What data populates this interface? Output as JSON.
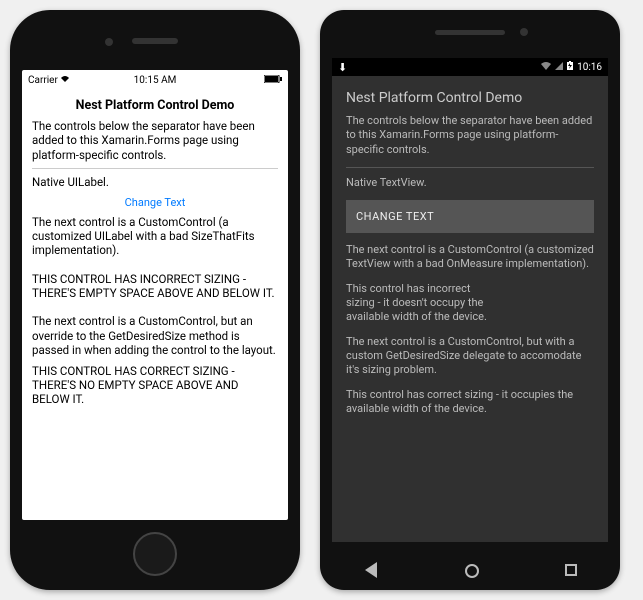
{
  "ios": {
    "status": {
      "carrier": "Carrier",
      "time": "10:15 AM"
    },
    "title": "Nest Platform Control Demo",
    "intro": "The controls below the separator have been added to this Xamarin.Forms page using platform-specific controls.",
    "native_label": "Native UILabel.",
    "change_text": "Change Text",
    "desc1": "The next control is a CustomControl (a customized UILabel with a bad SizeThatFits implementation).",
    "bad_sizing": "THIS CONTROL HAS INCORRECT SIZING - THERE'S EMPTY SPACE ABOVE AND BELOW IT.",
    "desc2": "The next control is a CustomControl, but an override to the GetDesiredSize method is passed in when adding the control to the layout.",
    "good_sizing": "THIS CONTROL HAS CORRECT SIZING - THERE'S NO EMPTY SPACE ABOVE AND BELOW IT."
  },
  "android": {
    "status": {
      "time": "10:16"
    },
    "title": "Nest Platform Control Demo",
    "intro": "The controls below the separator have been added to this Xamarin.Forms page using platform-specific controls.",
    "native_label": "Native TextView.",
    "change_text": "CHANGE TEXT",
    "desc1": "The next control is a CustomControl (a customized TextView with a bad OnMeasure implementation).",
    "bad_sizing": "This control has incorrect sizing - it doesn't occupy the available width of the device.",
    "desc2": "The next control is a CustomControl, but with a custom GetDesiredSize delegate to accomodate it's sizing problem.",
    "good_sizing": "This control has correct sizing - it occupies the available width of the device."
  }
}
